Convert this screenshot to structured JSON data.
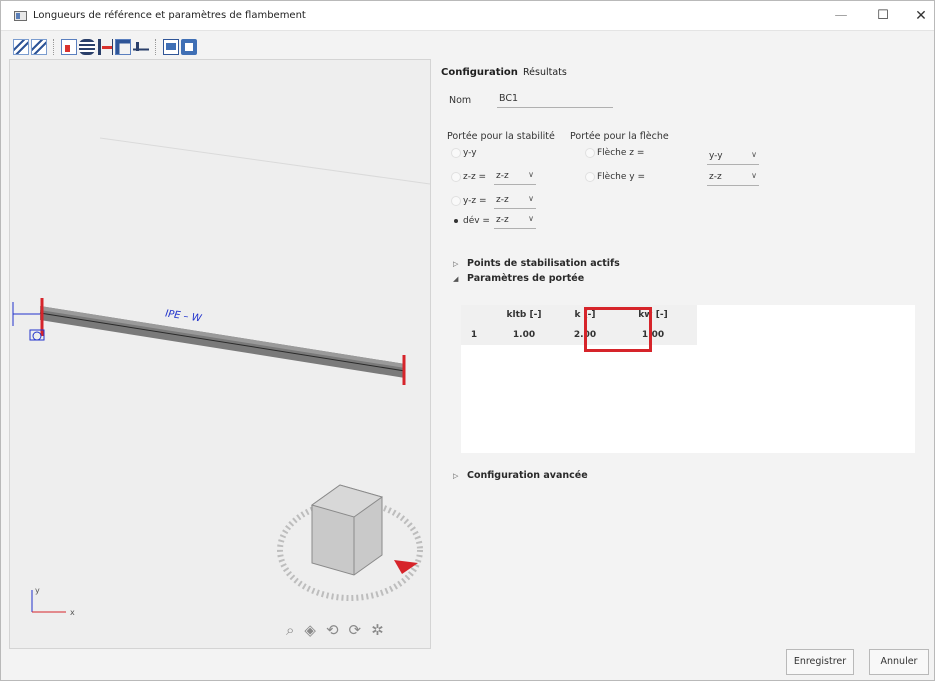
{
  "window": {
    "title": "Longueurs de référence et paramètres de flambement",
    "minimize_symbol": "—",
    "maximize_symbol": "☐",
    "close_symbol": "✕"
  },
  "toolbar": {
    "icons": [
      "buckling-icon-1",
      "buckling-icon-2",
      "member-select-icon",
      "layers-icon",
      "support-icon",
      "bracing-icon",
      "deflection-icon",
      "table-view-icon",
      "print-icon"
    ]
  },
  "view3d": {
    "member_label": "IPE – W",
    "axis_x": "x",
    "axis_y": "y",
    "tools": [
      "zoom-fit-icon",
      "view-cube-icon",
      "orbit-icon",
      "walk-icon",
      "settings-icon"
    ]
  },
  "tabs": {
    "configuration": "Configuration",
    "resultats": "Résultats"
  },
  "config": {
    "name_label": "Nom",
    "name_value": "BC1",
    "stability_header": "Portée pour la stabilité",
    "deflection_header": "Portée pour la flèche",
    "stability_rows": [
      {
        "label": "y-y",
        "combo": "",
        "checked": false
      },
      {
        "label": "z-z =",
        "combo": "z-z",
        "checked": false
      },
      {
        "label": "y-z =",
        "combo": "z-z",
        "checked": false
      },
      {
        "label": "dév =",
        "combo": "z-z",
        "checked": true
      }
    ],
    "deflection_rows": [
      {
        "label": "Flèche z =",
        "combo": "y-y"
      },
      {
        "label": "Flèche y =",
        "combo": "z-z"
      }
    ]
  },
  "sections": {
    "active_points": "Points de stabilisation actifs",
    "span_params": "Paramètres de portée",
    "advanced": "Configuration avancée"
  },
  "grid": {
    "headers": [
      "",
      "kltb [-]",
      "k [-]",
      "kw [-]"
    ],
    "rows": [
      {
        "idx": "1",
        "kltb": "1.00",
        "k": "2.00",
        "kw": "1.00"
      }
    ]
  },
  "buttons": {
    "save": "Enregistrer",
    "cancel": "Annuler"
  },
  "colors": {
    "highlight": "#d6242a",
    "beam": "#6e6e6e",
    "member_label": "#2233cc"
  }
}
